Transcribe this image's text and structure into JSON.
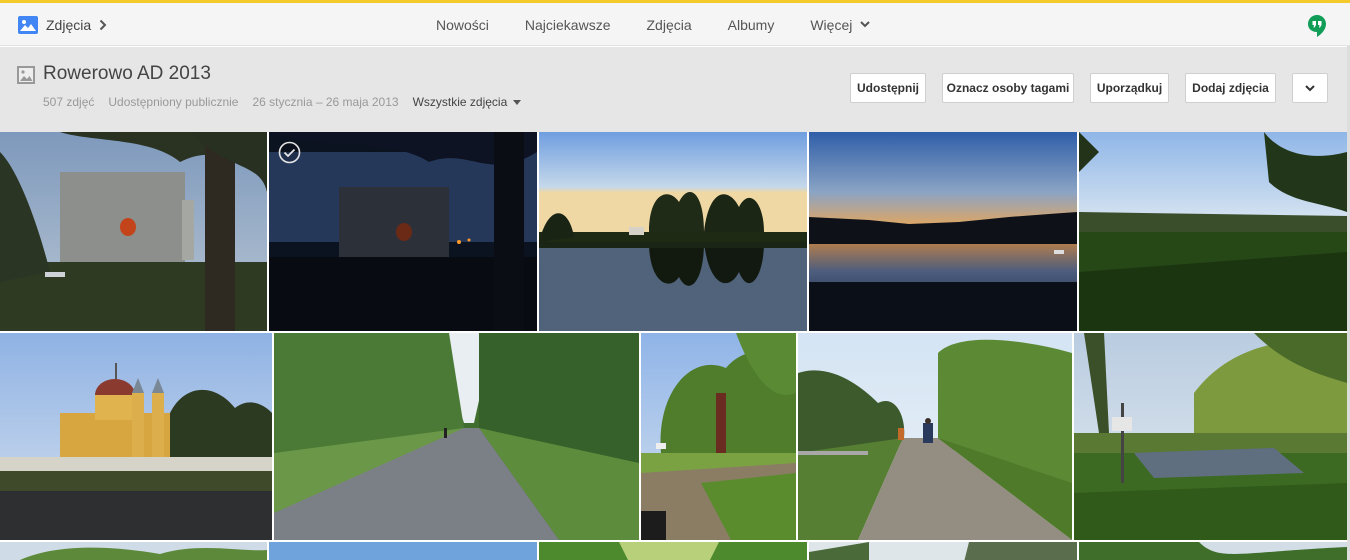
{
  "app": {
    "brand_label": "Zdjęcia",
    "nav": [
      {
        "label": "Nowości"
      },
      {
        "label": "Najciekawsze"
      },
      {
        "label": "Zdjęcia"
      },
      {
        "label": "Albumy"
      },
      {
        "label": "Więcej"
      }
    ]
  },
  "album": {
    "title": "Rowerowo AD 2013",
    "photo_count": "507 zdjęć",
    "visibility": "Udostępniony publicznie",
    "date_range": "26 stycznia – 26 maja 2013",
    "filter_label": "Wszystkie zdjęcia"
  },
  "toolbar": {
    "share_label": "Udostępnij",
    "tag_people_label": "Oznacz osoby tagami",
    "organize_label": "Uporządkuj",
    "add_photos_label": "Dodaj zdjęcia"
  },
  "colors": {
    "accent_line": "#f3c92b",
    "brand_blue": "#4285f4",
    "hangouts_green": "#0f9d58"
  }
}
